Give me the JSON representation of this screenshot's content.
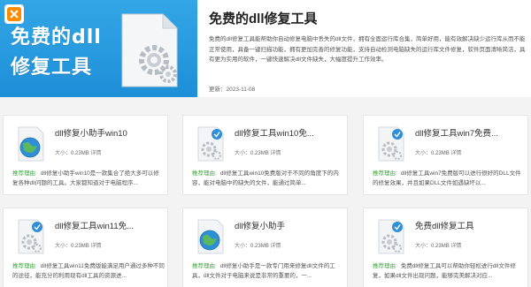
{
  "hero": {
    "banner_line1": "免费的dll",
    "banner_line2": "修复工具",
    "title": "免费的dll修复工具",
    "description": "免费的dll修复工具能帮助你自动修复电脑中丢失的dll文件，拥有全面运行库合集，简单好用，能有效解决缺少运行库从而不能正常使用，具备一键扫描功能，拥有更加完善的修复功能，支持自动检测电脑缺失的运行库文件修复，软件页面清晰简洁，具有更为实用的软件，一键快速解决dll文件缺失，大幅度提升工作效率。",
    "date": "更新：2023-11-08"
  },
  "cards": [
    {
      "title": "dll修复小助手win10",
      "size_label": "大小：",
      "size": "0.23MB",
      "detail": "详情",
      "reason_label": "推荐理由:",
      "reason": "dll修复小助手win10是一款集合了绝大多可以修复各种dll问题的工具。大家都知道对于电脑程序..."
    },
    {
      "title": "dll修复工具win10免...",
      "size_label": "大小：",
      "size": "0.23MB",
      "detail": "详情",
      "reason_label": "推荐理由:",
      "reason": "dll修复工具win10免费版对于不同的角度下的内容，能对电脑中的缺失的文件，能通过简单..."
    },
    {
      "title": "dll修复工具win7免费...",
      "size_label": "大小：",
      "size": "0.23MB",
      "detail": "详情",
      "reason_label": "推荐理由:",
      "reason": "dll修复工具win7免费版可以进行很好的DLL文件的修复效果，并且如果DLL文件如遇缺坏以..."
    },
    {
      "title": "dll修复工具win11免...",
      "size_label": "大小：",
      "size": "0.23MB",
      "detail": "详情",
      "reason_label": "推荐理由:",
      "reason": "dll修复工具win11免费版能满足用户通过多种不同的途径，能充分的利用现有dll工具的资源进..."
    },
    {
      "title": "dll修复小助手",
      "size_label": "大小：",
      "size": "0.23MB",
      "detail": "详情",
      "reason_label": "推荐理由:",
      "reason": "dll修复小助手是一款专门用来修复dll文件的工具，dll文件对于电脑来说是非常的重要的，一..."
    },
    {
      "title": "免费dll修复工具",
      "size_label": "大小：",
      "size": "0.23MB",
      "detail": "详情",
      "reason_label": "推荐理由:",
      "reason": "免费dll修复工具可以帮助你轻松进行dll文件修复，如果dll文件出现问题，能够完美解决对应..."
    }
  ],
  "colors": {
    "banner": "#1e8fd8",
    "reason_label": "#3ca83c"
  }
}
